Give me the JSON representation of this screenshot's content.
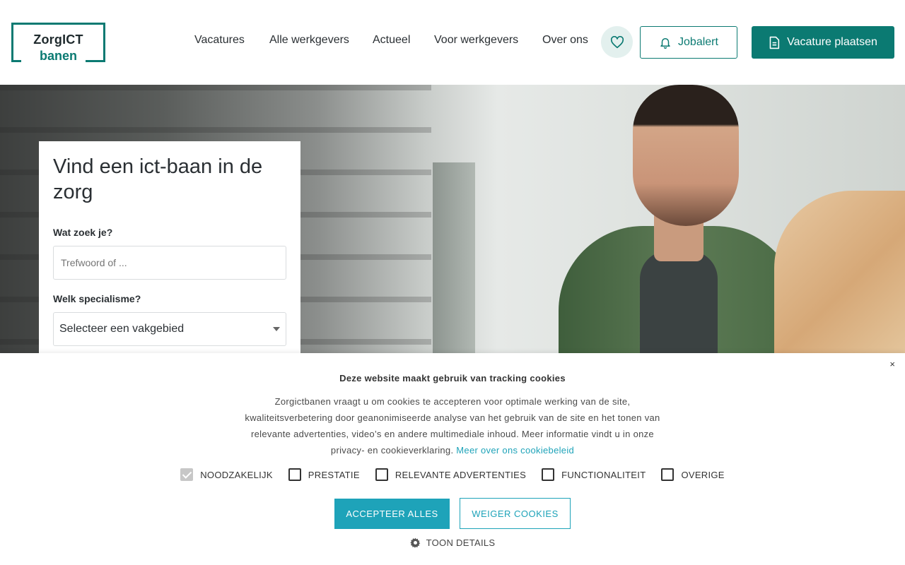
{
  "header": {
    "logo": {
      "line1": "ZorgICT",
      "line2": "banen"
    },
    "nav": [
      "Vacatures",
      "Alle werkgevers",
      "Actueel",
      "Voor werkgevers",
      "Over ons"
    ],
    "favorites_icon": "heart-icon",
    "jobalert_label": "Jobalert",
    "jobalert_icon": "bell-icon",
    "post_vacancy_label": "Vacature plaatsen",
    "post_vacancy_icon": "document-icon"
  },
  "search": {
    "title": "Vind een ict-baan in de zorg",
    "what_label": "Wat zoek je?",
    "what_placeholder": "Trefwoord of ...",
    "specialism_label": "Welk specialisme?",
    "specialism_selected": "Selecteer een vakgebied"
  },
  "cookie": {
    "close": "×",
    "title": "Deze website maakt gebruik van tracking cookies",
    "body": "Zorgictbanen vraagt u om cookies te accepteren voor optimale werking van de site, kwaliteitsverbetering door geanonimiseerde analyse van het gebruik van de site en het tonen van relevante advertenties, video’s en andere multimediale inhoud. Meer informatie vindt u in onze privacy- en cookieverklaring.",
    "link": "Meer over ons cookiebeleid",
    "options": [
      {
        "label": "NOODZAKELIJK",
        "checked": true
      },
      {
        "label": "PRESTATIE",
        "checked": false
      },
      {
        "label": "RELEVANTE ADVERTENTIES",
        "checked": false
      },
      {
        "label": "FUNCTIONALITEIT",
        "checked": false
      },
      {
        "label": "OVERIGE",
        "checked": false
      }
    ],
    "accept": "ACCEPTEER ALLES",
    "reject": "WEIGER COOKIES",
    "details": "TOON DETAILS",
    "details_icon": "gear-icon"
  },
  "colors": {
    "brand": "#0b7a72",
    "cookie_accent": "#1ea3b9"
  }
}
